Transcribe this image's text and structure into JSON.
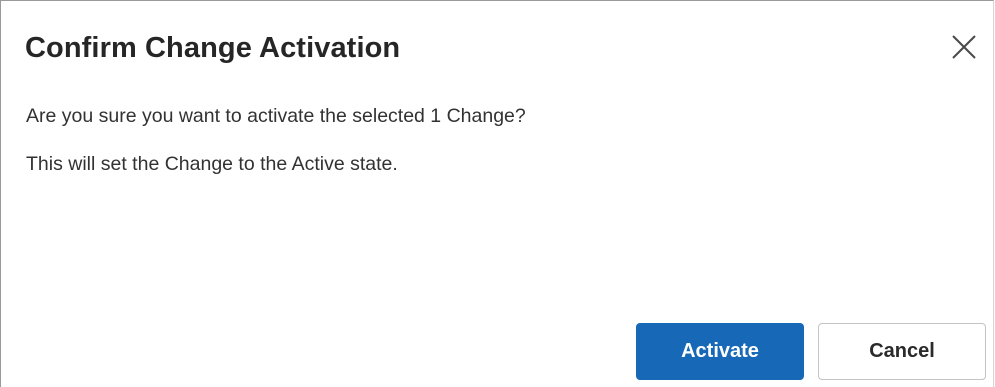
{
  "dialog": {
    "title": "Confirm Change Activation",
    "close_icon": "close-icon",
    "message_line1": "Are you sure you want to activate the selected 1 Change?",
    "message_line2": "This will set the Change to the Active state."
  },
  "buttons": {
    "activate_label": "Activate",
    "cancel_label": "Cancel"
  },
  "colors": {
    "primary": "#1769b8",
    "title_text": "#262626",
    "body_text": "#323232",
    "secondary_border": "#c4c4c4"
  }
}
